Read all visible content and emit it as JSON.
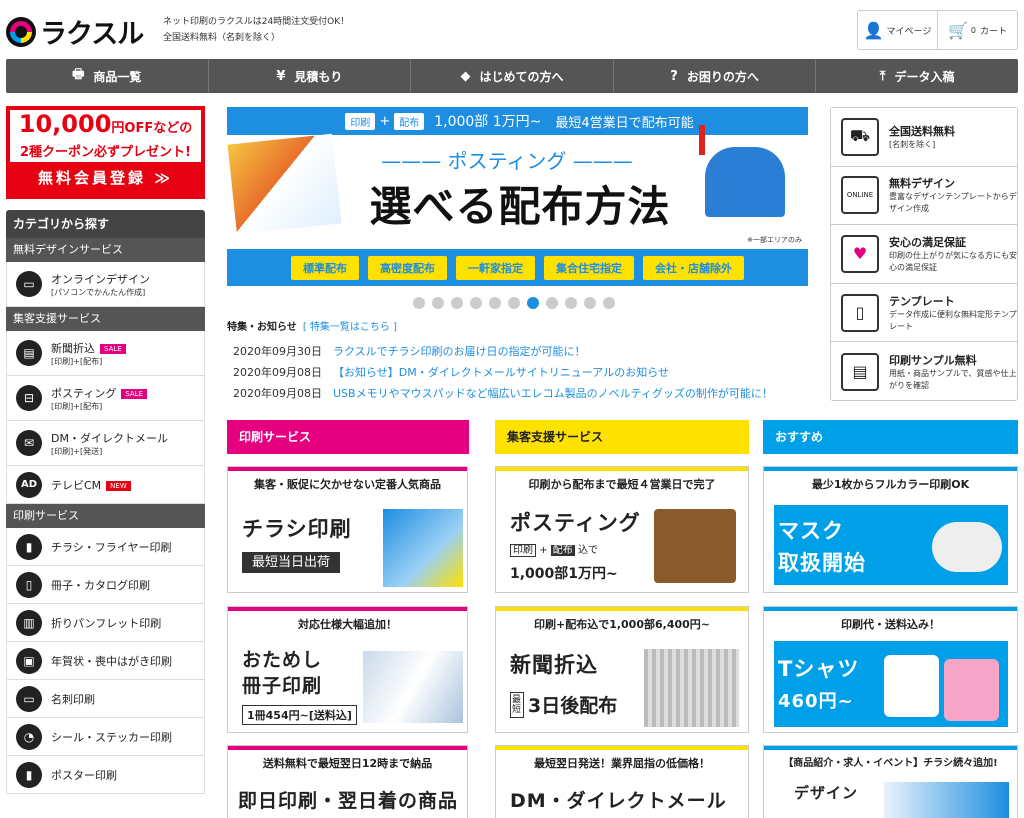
{
  "header": {
    "logo": "ラクスル",
    "tagline1": "ネット印刷のラクスルは24時間注文受付OK！",
    "tagline2": "全国送料無料（名刺を除く）",
    "mypage": "マイページ",
    "cart_count": "0",
    "cart": "カート"
  },
  "nav": [
    {
      "label": "商品一覧",
      "icon": "printer-icon"
    },
    {
      "label": "見積もり",
      "icon": "yen-icon"
    },
    {
      "label": "はじめての方へ",
      "icon": "beginner-icon"
    },
    {
      "label": "お困りの方へ",
      "icon": "question-icon"
    },
    {
      "label": "データ入稿",
      "icon": "upload-icon"
    }
  ],
  "coupon": {
    "amount": "10,000",
    "unit": "円OFFなどの",
    "line2": "2種クーポン必ずプレゼント!",
    "line3": "無料会員登録 ≫"
  },
  "sidebar": {
    "header": "カテゴリから探す",
    "sec1": "無料デザインサービス",
    "online": {
      "label": "オンラインデザイン",
      "sub": "[パソコンでかんたん作成]"
    },
    "sec2": "集客支援サービス",
    "items": [
      {
        "label": "新聞折込",
        "badge": "SALE",
        "sub": "[印刷]+[配布]"
      },
      {
        "label": "ポスティング",
        "badge": "SALE",
        "sub": "[印刷]+[配布]"
      },
      {
        "label": "DM・ダイレクトメール",
        "badge": "",
        "sub": "[印刷]+[発送]"
      },
      {
        "label": "テレビCM",
        "badge": "NEW",
        "sub": ""
      }
    ],
    "sec3": "印刷サービス",
    "print": [
      "チラシ・フライヤー印刷",
      "冊子・カタログ印刷",
      "折りパンフレット印刷",
      "年賀状・喪中はがき印刷",
      "名刺印刷",
      "シール・ステッカー印刷",
      "ポスター印刷"
    ]
  },
  "hero": {
    "tag1": "印刷",
    "plus": "+",
    "tag2": "配布",
    "price": "1,000部 1万円~",
    "lead": "最短4営業日で配布可能",
    "sub": "——— ポスティング ———",
    "title": "選べる配布方法",
    "note": "※一部エリアのみ",
    "buttons": [
      "標準配布",
      "高密度配布",
      "一軒家指定",
      "集合住宅指定",
      "会社・店舗除外"
    ]
  },
  "news": {
    "heading": "特集・お知らせ",
    "link": "[ 特集一覧はこちら ]",
    "items": [
      {
        "date": "2020年09月30日",
        "text": "ラクスルでチラシ印刷のお届け日の指定が可能に！"
      },
      {
        "date": "2020年09月08日",
        "text": "【お知らせ】DM・ダイレクトメールサイトリニューアルのお知らせ"
      },
      {
        "date": "2020年09月08日",
        "text": "USBメモリやマウスパッドなど幅広いエレコム製品のノベルティグッズの制作が可能に！"
      }
    ]
  },
  "features": [
    {
      "title": "全国送料無料",
      "sub": "[名刺を除く]",
      "icon": "truck-icon"
    },
    {
      "title": "無料デザイン",
      "sub": "豊富なデザインテンプレートからデザイン作成",
      "icon": "online-design-icon"
    },
    {
      "title": "安心の満足保証",
      "sub": "印刷の仕上がりが気になる方にも安心の満足保証",
      "icon": "heart-hands-icon"
    },
    {
      "title": "テンプレート",
      "sub": "データ作成に便利な無料定形テンプレート",
      "icon": "template-icon"
    },
    {
      "title": "印刷サンプル無料",
      "sub": "用紙・商品サンプルで、質感や仕上がりを確認",
      "icon": "samples-icon"
    }
  ],
  "columns": {
    "print": "印刷サービス",
    "support": "集客支援サービス",
    "recommend": "おすすめ"
  },
  "cards": {
    "c1": {
      "head": "集客・販促に欠かせない定番人気商品",
      "title": "チラシ印刷",
      "badge": "最短当日出荷"
    },
    "c2": {
      "head": "印刷から配布まで最短４営業日で完了",
      "title": "ポスティング",
      "tag1": "印刷",
      "plus": "+",
      "tag2": "配布",
      "suffix": "込で",
      "price": "1,000部1万円~"
    },
    "c3": {
      "head": "最少1枚からフルカラー印刷OK",
      "title1": "マスク",
      "title2": "取扱開始"
    },
    "c4": {
      "head": "対応仕様大幅追加！",
      "title1": "おためし",
      "title2": "冊子印刷",
      "price": "1冊454円~[送料込]"
    },
    "c5": {
      "head": "印刷+配布込で1,000部6,400円~",
      "title": "新聞折込",
      "tag": "最短",
      "days": "3日後配布"
    },
    "c6": {
      "head": "印刷代・送料込み！",
      "title": "Tシャツ",
      "price": "460円~"
    },
    "c7": {
      "head": "送料無料で最短翌日12時まで納品",
      "title": "即日印刷・翌日着の商品"
    },
    "c8": {
      "head": "最短翌日発送！業界屈指の低価格！",
      "title": "DM・ダイレクトメール"
    },
    "c9": {
      "head": "【商品紹介・求人・イベント】チラシ続々追加!",
      "title": "デザイン"
    }
  },
  "colors": {
    "magenta": "#e4007f",
    "yellow": "#ffe100",
    "cyan": "#00a0e9",
    "blue": "#1e8ee0",
    "red": "#e60012",
    "nav": "#555555"
  }
}
